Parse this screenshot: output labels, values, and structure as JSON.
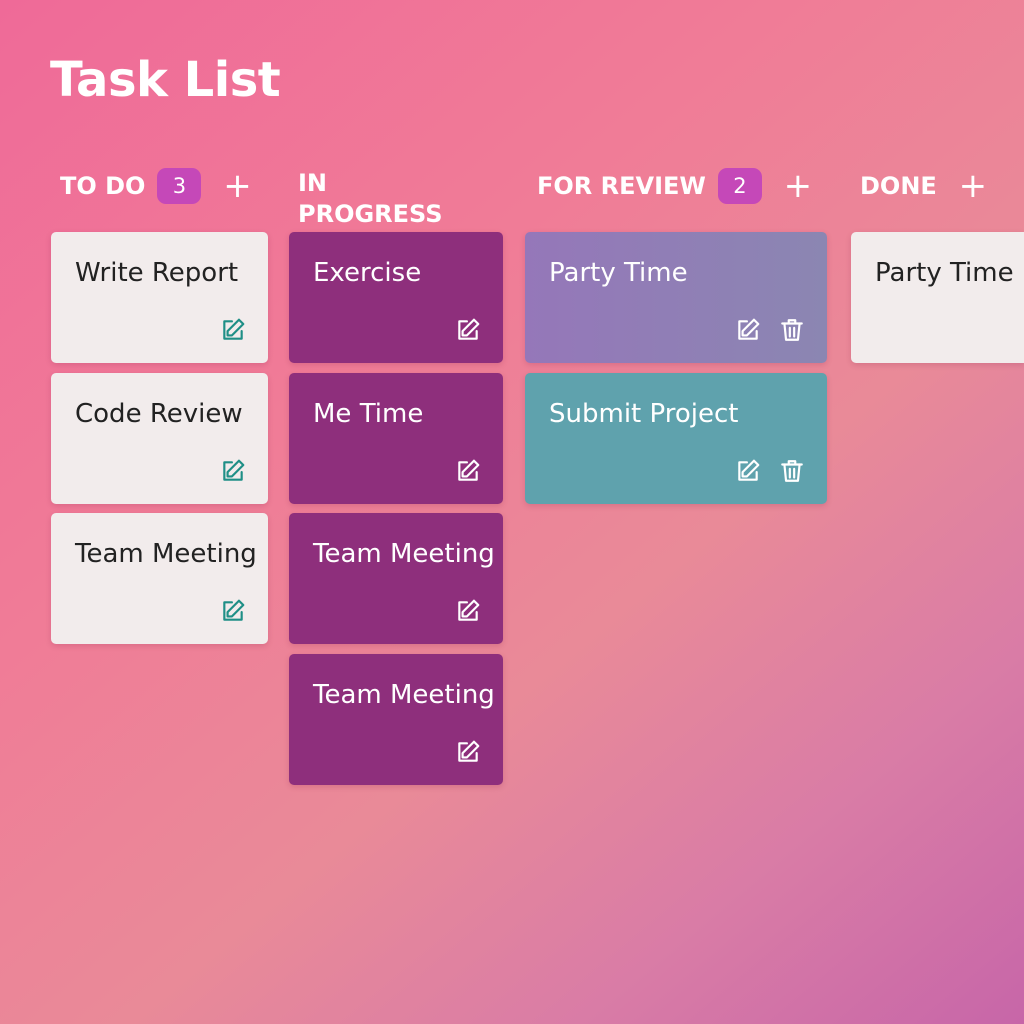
{
  "page": {
    "title": "Task List"
  },
  "columns": [
    {
      "title": "TO DO",
      "count": "3",
      "add_label": "+",
      "cards": [
        {
          "title": "Write Report",
          "actions": [
            "edit-icon"
          ]
        },
        {
          "title": "Code Review",
          "actions": [
            "edit-icon"
          ]
        },
        {
          "title": "Team Meeting",
          "actions": [
            "edit-icon"
          ]
        }
      ]
    },
    {
      "title": "IN PROGRESS",
      "cards": [
        {
          "title": "Exercise",
          "actions": [
            "edit-icon"
          ]
        },
        {
          "title": "Me Time",
          "actions": [
            "edit-icon"
          ]
        },
        {
          "title": "Team Meeting",
          "actions": [
            "edit-icon"
          ]
        },
        {
          "title": "Team Meeting",
          "actions": [
            "edit-icon"
          ]
        }
      ]
    },
    {
      "title": "FOR REVIEW",
      "count": "2",
      "add_label": "+",
      "cards": [
        {
          "title": "Party Time",
          "actions": [
            "edit-icon",
            "trash-icon"
          ]
        },
        {
          "title": "Submit Project",
          "actions": [
            "edit-icon",
            "trash-icon"
          ]
        }
      ]
    },
    {
      "title": "DONE",
      "add_label": "+",
      "cards": [
        {
          "title": "Party Time",
          "actions": []
        }
      ]
    }
  ],
  "colors": {
    "background": "#ef6a98",
    "badge": "#c548b8",
    "card_light": "#f2ecec",
    "card_purple": "#8e2f7c",
    "card_lavender": "#9577b9",
    "card_teal": "#5fa2ad",
    "edit_icon_teal": "#1f8f86"
  }
}
